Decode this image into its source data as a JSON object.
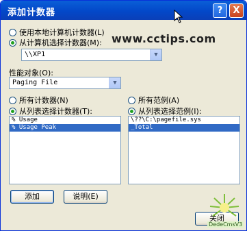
{
  "window": {
    "title": "添加计数器"
  },
  "titlebar": {
    "help_label": "?",
    "close_label": "X"
  },
  "source": {
    "local_label": "使用本地计算机计数器(L)",
    "remote_label": "从计算机选择计数器(M):",
    "selected": "remote",
    "computer_value": "\\\\XP1"
  },
  "watermark": "www.cctips.com",
  "perf_object": {
    "label": "性能对象(O):",
    "value": "Paging File"
  },
  "counters": {
    "all_label": "所有计数器(N)",
    "list_label": "从列表选择计数器(T):",
    "items": [
      "% Usage",
      "% Usage Peak"
    ],
    "selected_index": 1
  },
  "instances": {
    "all_label": "所有范例(A)",
    "list_label": "从列表选择范例(I):",
    "items": [
      "\\??\\C:\\pagefile.sys",
      "_Total"
    ],
    "selected_index": 1
  },
  "buttons": {
    "add": "添加",
    "explain": "说明(E)",
    "close": "关闭"
  },
  "logo": {
    "text": "DedeCmsV3"
  },
  "icons": {
    "arrow": "chevron-down-icon",
    "cursor": "mouse-pointer-icon"
  }
}
